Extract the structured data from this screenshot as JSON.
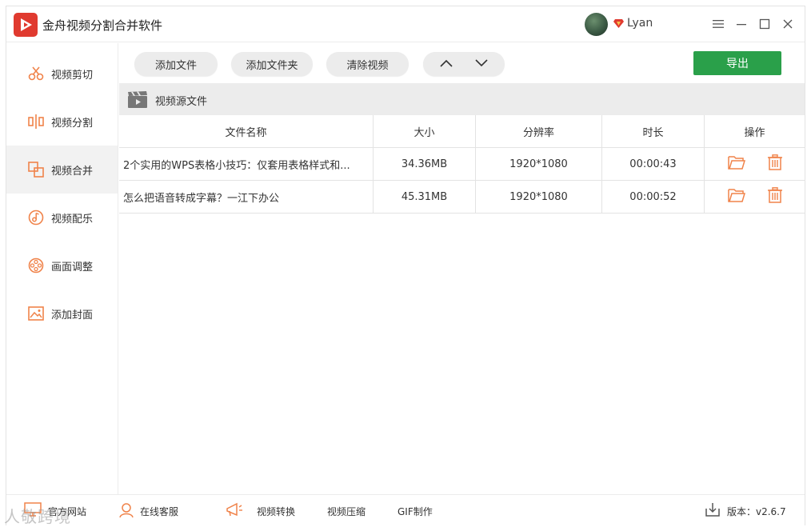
{
  "app": {
    "title": "金舟视频分割合并软件",
    "logo_color": "#e03a2f"
  },
  "user": {
    "name": "Lyan",
    "vip_icon": "diamond-icon"
  },
  "window_controls": [
    "menu-icon",
    "minimize-icon",
    "maximize-icon",
    "close-icon"
  ],
  "sidebar": {
    "items": [
      {
        "label": "视频剪切",
        "icon": "scissors-icon"
      },
      {
        "label": "视频分割",
        "icon": "split-icon"
      },
      {
        "label": "视频合并",
        "icon": "merge-icon"
      },
      {
        "label": "视频配乐",
        "icon": "music-icon"
      },
      {
        "label": "画面调整",
        "icon": "film-reel-icon"
      },
      {
        "label": "添加封面",
        "icon": "image-icon"
      }
    ],
    "active_index": 2
  },
  "toolbar": {
    "add_file": "添加文件",
    "add_folder": "添加文件夹",
    "clear": "清除视频",
    "export": "导出"
  },
  "source": {
    "title": "视频源文件"
  },
  "table": {
    "headers": [
      "文件名称",
      "大小",
      "分辨率",
      "时长",
      "操作"
    ],
    "rows": [
      {
        "name": "2个实用的WPS表格小技巧：仅套用表格样式和...",
        "size": "34.36MB",
        "resolution": "1920*1080",
        "duration": "00:00:43"
      },
      {
        "name": "怎么把语音转成字幕？一江下办公",
        "size": "45.31MB",
        "resolution": "1920*1080",
        "duration": "00:00:52"
      }
    ]
  },
  "footer": {
    "website": "官方网站",
    "service": "在线客服",
    "convert": "视频转换",
    "compress": "视频压缩",
    "gif": "GIF制作",
    "version": "版本：v2.6.7"
  },
  "watermark": "人敬跨境",
  "colors": {
    "accent_orange": "#f0834a",
    "export_green": "#2aa04a",
    "sidebar_active": "#f2f2f2"
  }
}
